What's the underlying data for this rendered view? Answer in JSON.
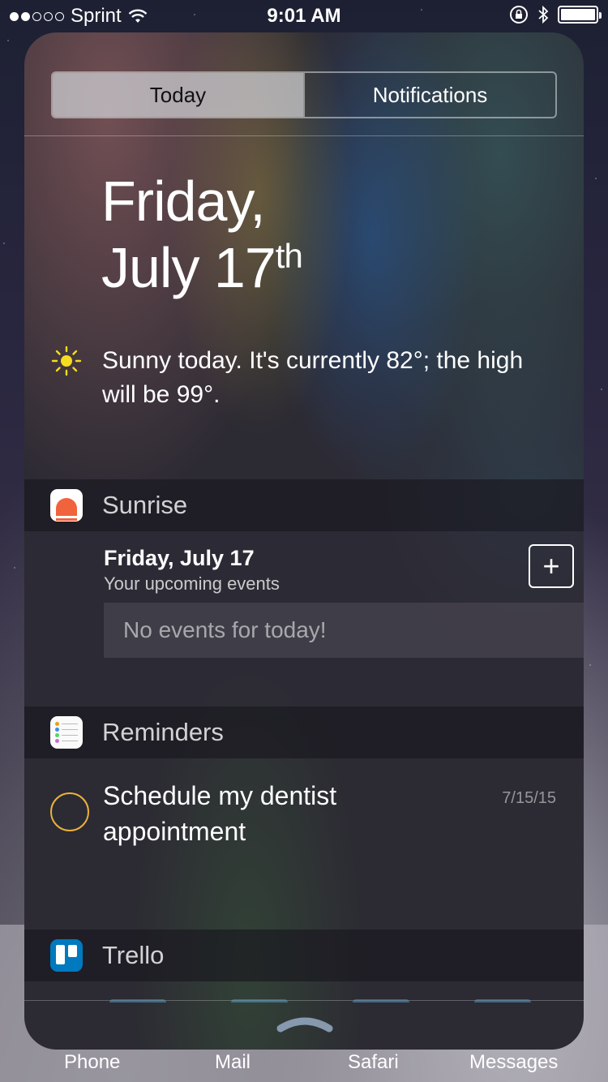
{
  "status_bar": {
    "carrier": "Sprint",
    "time": "9:01 AM",
    "signal_bars_filled": 2,
    "signal_bars_total": 5
  },
  "segments": {
    "today": "Today",
    "notifications": "Notifications",
    "selected": "Today"
  },
  "date": {
    "line1": "Friday,",
    "line2_main": "July 17",
    "line2_suffix": "th"
  },
  "weather": {
    "icon": "sun-icon",
    "summary": "Sunny today. It's currently 82°; the high will be 99°."
  },
  "sunrise_widget": {
    "title": "Sunrise",
    "day_label": "Friday, July 17",
    "subtitle": "Your upcoming events",
    "add_label": "+",
    "empty_message": "No events for today!"
  },
  "reminders_widget": {
    "title": "Reminders",
    "items": [
      {
        "text": "Schedule my dentist appointment",
        "date": "7/15/15"
      }
    ]
  },
  "trello_widget": {
    "title": "Trello"
  },
  "dock": {
    "apps": [
      "Phone",
      "Mail",
      "Safari",
      "Messages"
    ]
  },
  "colors": {
    "reminder_circle": "#e9b23a",
    "sun": "#f5dc1e",
    "sunrise_brand": "#f0633d",
    "trello_brand": "#0079bf"
  }
}
